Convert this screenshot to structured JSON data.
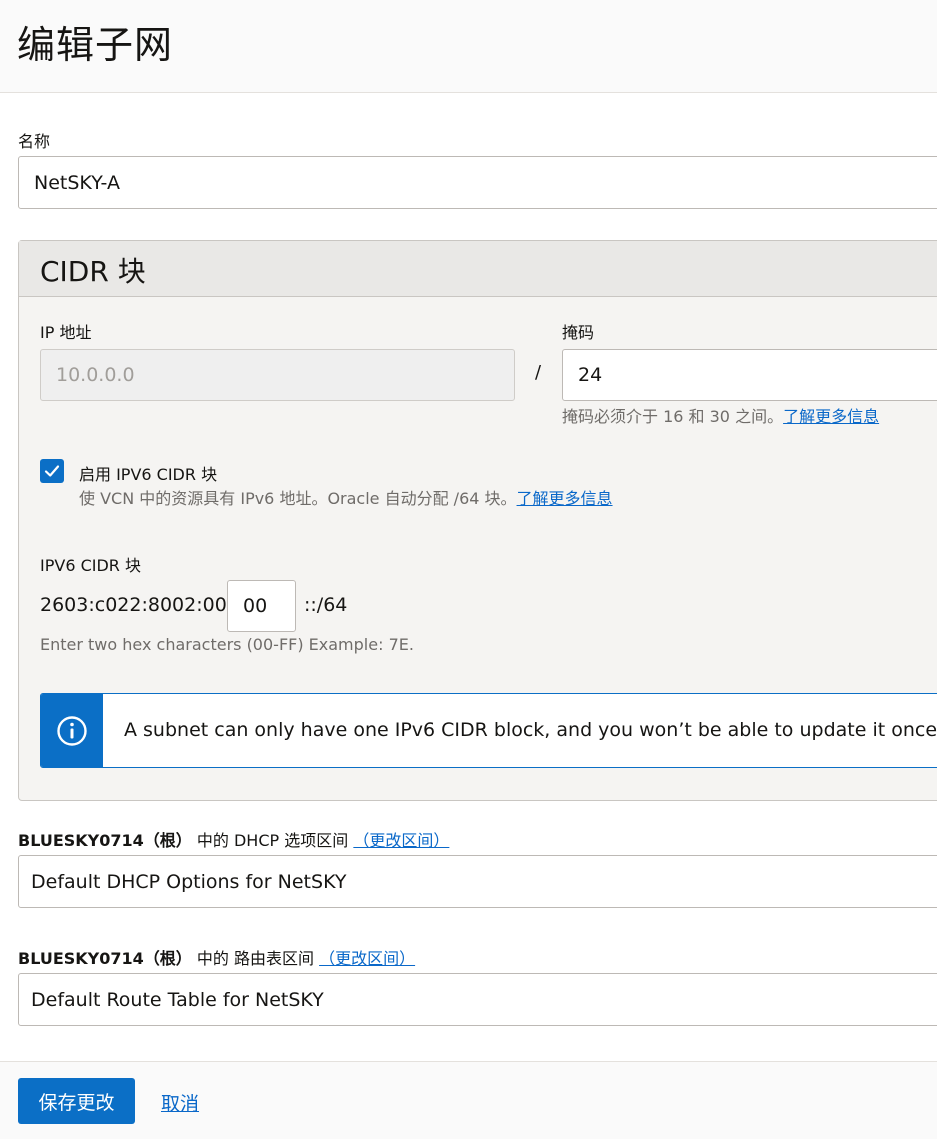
{
  "header": {
    "title": "编辑子网"
  },
  "name_field": {
    "label": "名称",
    "value": "NetSKY-A"
  },
  "cidr": {
    "title": "CIDR 块",
    "ip_label": "IP 地址",
    "ip_value": "10.0.0.0",
    "slash": "/",
    "mask_label": "掩码",
    "mask_value": "24",
    "mask_hint": "掩码必须介于 16 和 30 之间。",
    "mask_hint_link": "了解更多信息"
  },
  "ipv6": {
    "checkbox_label": "启用 IPV6 CIDR 块",
    "checked": true,
    "checkbox_hint": "使 VCN 中的资源具有 IPv6 地址。Oracle 自动分配 /64 块。",
    "checkbox_hint_link": "了解更多信息",
    "block_label": "IPV6 CIDR 块",
    "prefix": "2603:c022:8002:00",
    "hex_value": "00",
    "suffix": "::/64",
    "hex_hint": "Enter two hex characters (00-FF) Example: 7E."
  },
  "info_banner": {
    "icon": "info-icon",
    "text": "A subnet can only have one IPv6 CIDR block, and you won’t be able to update it once e"
  },
  "dhcp": {
    "compartment": "BLUESKY0714（根）",
    "label": "中的 DHCP 选项区间",
    "change_link": "（更改区间）",
    "value": "Default DHCP Options for NetSKY"
  },
  "route": {
    "compartment": "BLUESKY0714（根）",
    "label": "中的 路由表区间",
    "change_link": "（更改区间）",
    "value": "Default Route Table for NetSKY"
  },
  "footer": {
    "save_label": "保存更改",
    "cancel_label": "取消"
  },
  "colors": {
    "accent": "#0b6fc6",
    "link": "#0a68c9"
  }
}
